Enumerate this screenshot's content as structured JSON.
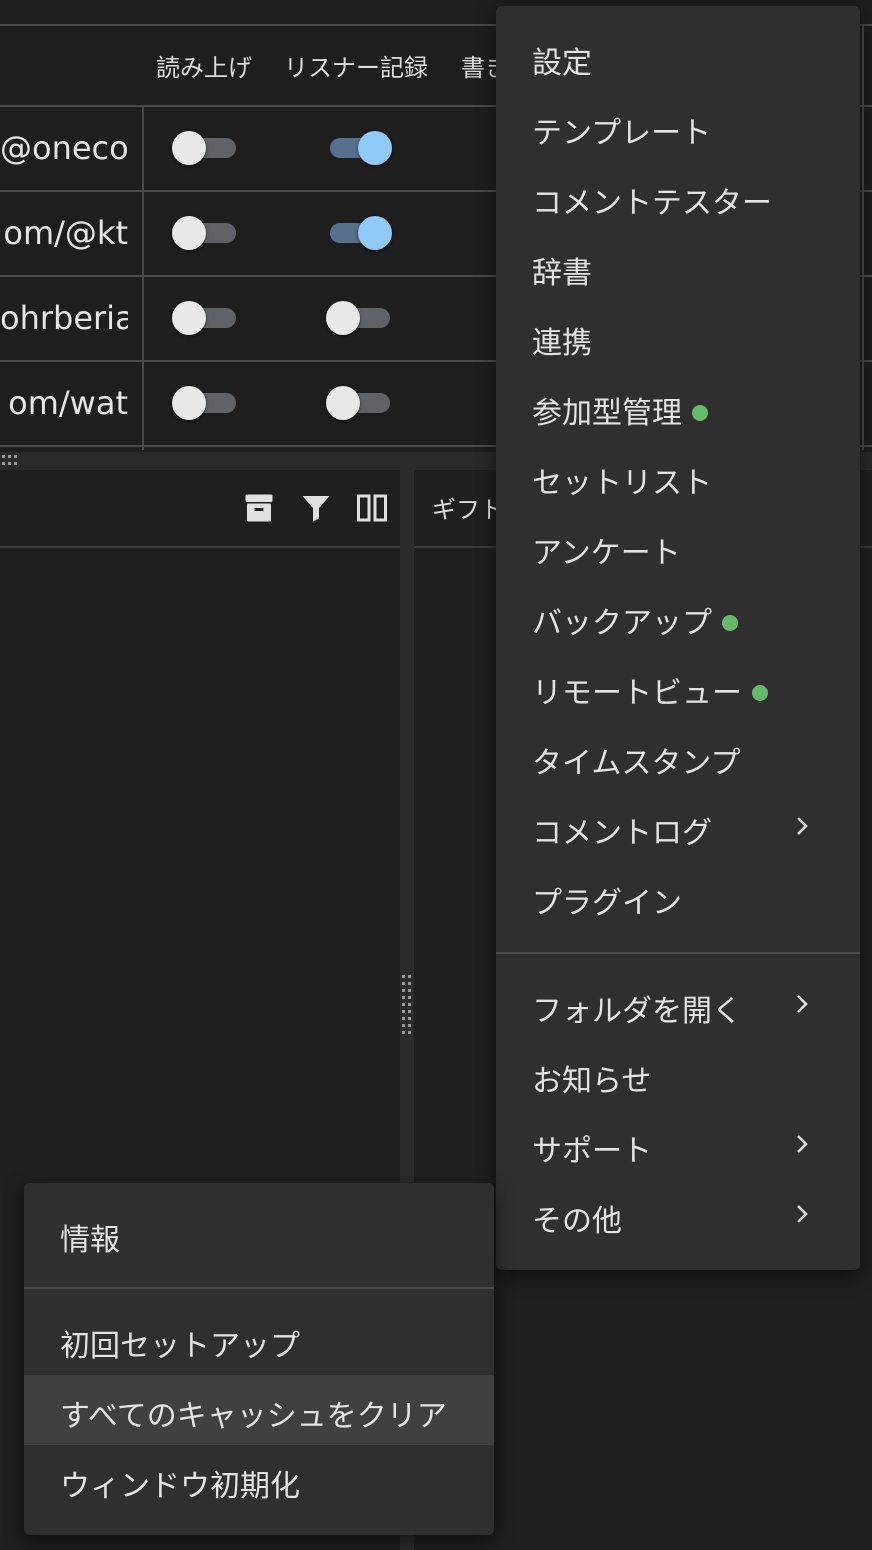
{
  "table": {
    "headers": [
      "読み上げ",
      "リスナー記録",
      "書き"
    ],
    "rows": [
      {
        "url": "@onecom",
        "read_aloud": false,
        "listener_record": true
      },
      {
        "url": "om/@kt",
        "read_aloud": false,
        "listener_record": true
      },
      {
        "url": "ohrberia",
        "read_aloud": false,
        "listener_record": false
      },
      {
        "url": "om/wat",
        "read_aloud": false,
        "listener_record": false
      }
    ]
  },
  "right_pane": {
    "title": "ギフト"
  },
  "left_toolbar": {
    "icons": [
      "archive-icon",
      "filter-icon",
      "columns-icon"
    ]
  },
  "main_menu": {
    "items": [
      {
        "label": "設定",
        "dot": false,
        "submenu": false
      },
      {
        "label": "テンプレート",
        "dot": false,
        "submenu": false
      },
      {
        "label": "コメントテスター",
        "dot": false,
        "submenu": false
      },
      {
        "label": "辞書",
        "dot": false,
        "submenu": false
      },
      {
        "label": "連携",
        "dot": false,
        "submenu": false
      },
      {
        "label": "参加型管理",
        "dot": true,
        "submenu": false
      },
      {
        "label": "セットリスト",
        "dot": false,
        "submenu": false
      },
      {
        "label": "アンケート",
        "dot": false,
        "submenu": false
      },
      {
        "label": "バックアップ",
        "dot": true,
        "submenu": false
      },
      {
        "label": "リモートビュー",
        "dot": true,
        "submenu": false
      },
      {
        "label": "タイムスタンプ",
        "dot": false,
        "submenu": false
      },
      {
        "label": "コメントログ",
        "dot": false,
        "submenu": true
      },
      {
        "label": "プラグイン",
        "dot": false,
        "submenu": false
      }
    ],
    "items2": [
      {
        "label": "フォルダを開く",
        "submenu": true
      },
      {
        "label": "お知らせ",
        "submenu": false
      },
      {
        "label": "サポート",
        "submenu": true
      },
      {
        "label": "その他",
        "submenu": true
      }
    ],
    "dot_color": "#66bb6a"
  },
  "sub_menu": {
    "items": [
      {
        "label": "情報"
      },
      {
        "label": "初回セットアップ"
      },
      {
        "label": "すべてのキャッシュをクリア",
        "highlighted": true
      },
      {
        "label": "ウィンドウ初期化"
      }
    ]
  }
}
